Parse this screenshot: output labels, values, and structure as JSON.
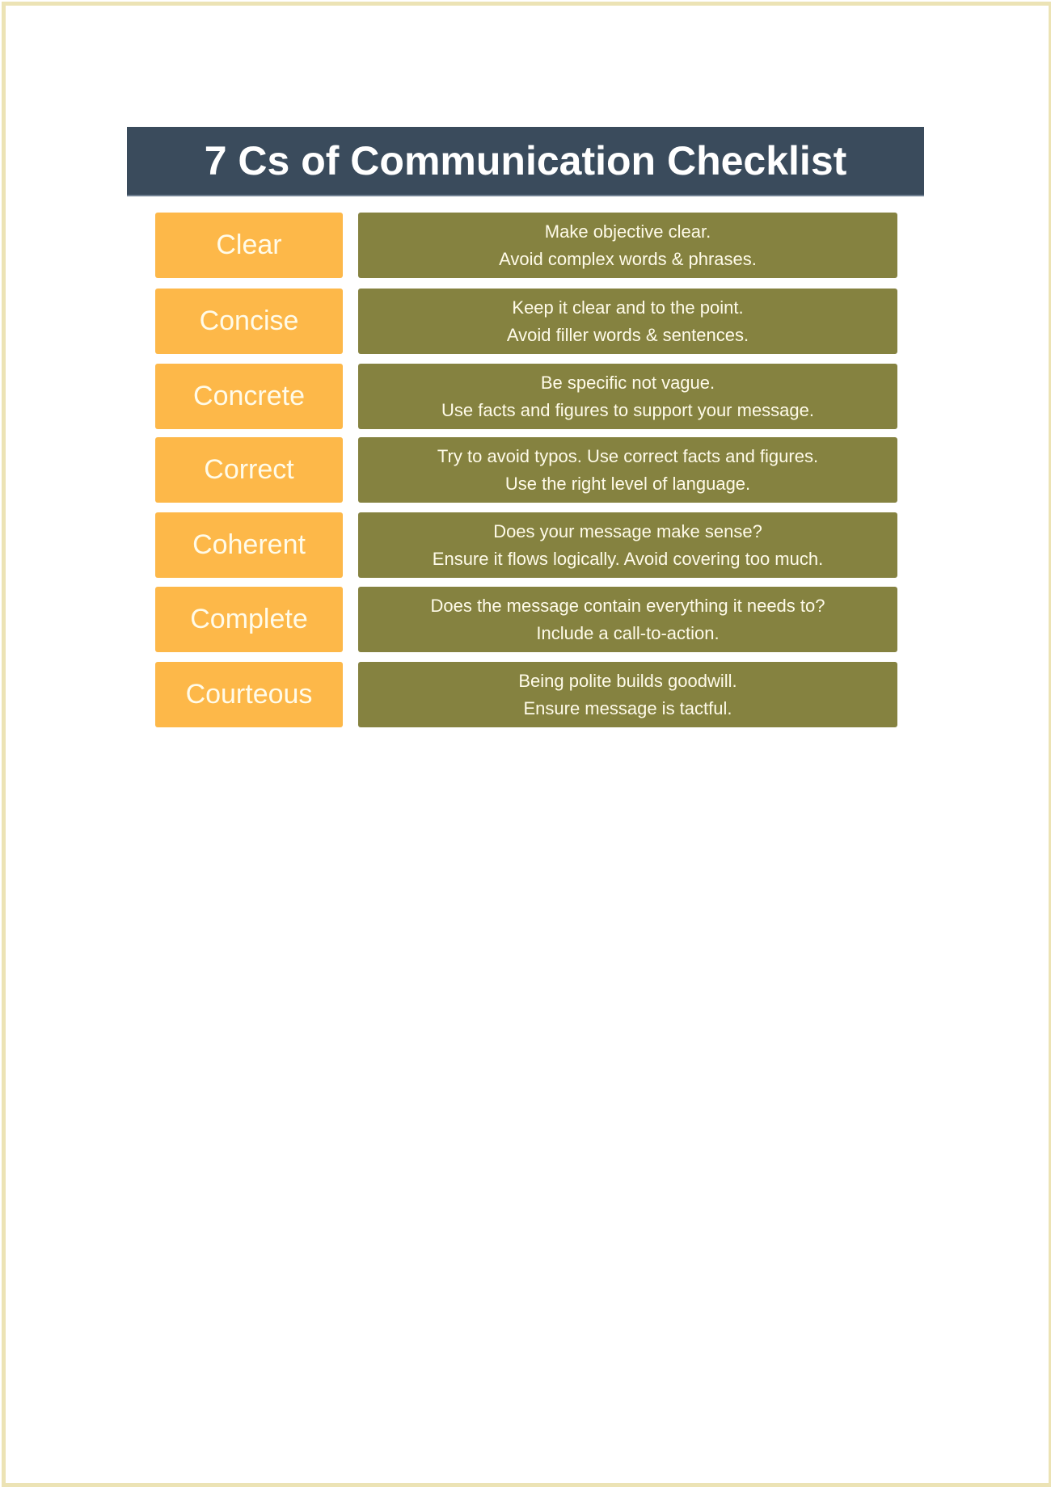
{
  "title": "7 Cs of Communication Checklist",
  "colors": {
    "header_bg": "#3a4b5c",
    "term_bg": "#fdb849",
    "desc_bg": "#858240",
    "page_border": "#ece3b5"
  },
  "items": [
    {
      "term": "Clear",
      "line1": "Make objective clear.",
      "line2": "Avoid complex words & phrases."
    },
    {
      "term": "Concise",
      "line1": "Keep it clear and to the point.",
      "line2": "Avoid filler words & sentences."
    },
    {
      "term": "Concrete",
      "line1": "Be specific not vague.",
      "line2": "Use facts and figures to support your message."
    },
    {
      "term": "Correct",
      "line1": "Try to avoid typos. Use correct facts and figures.",
      "line2": "Use the right level of language."
    },
    {
      "term": "Coherent",
      "line1": "Does your message make sense?",
      "line2": "Ensure it flows logically. Avoid covering too much."
    },
    {
      "term": "Complete",
      "line1": "Does the message contain everything it needs to?",
      "line2": "Include a call-to-action."
    },
    {
      "term": "Courteous",
      "line1": "Being polite builds goodwill.",
      "line2": "Ensure message is tactful."
    }
  ]
}
